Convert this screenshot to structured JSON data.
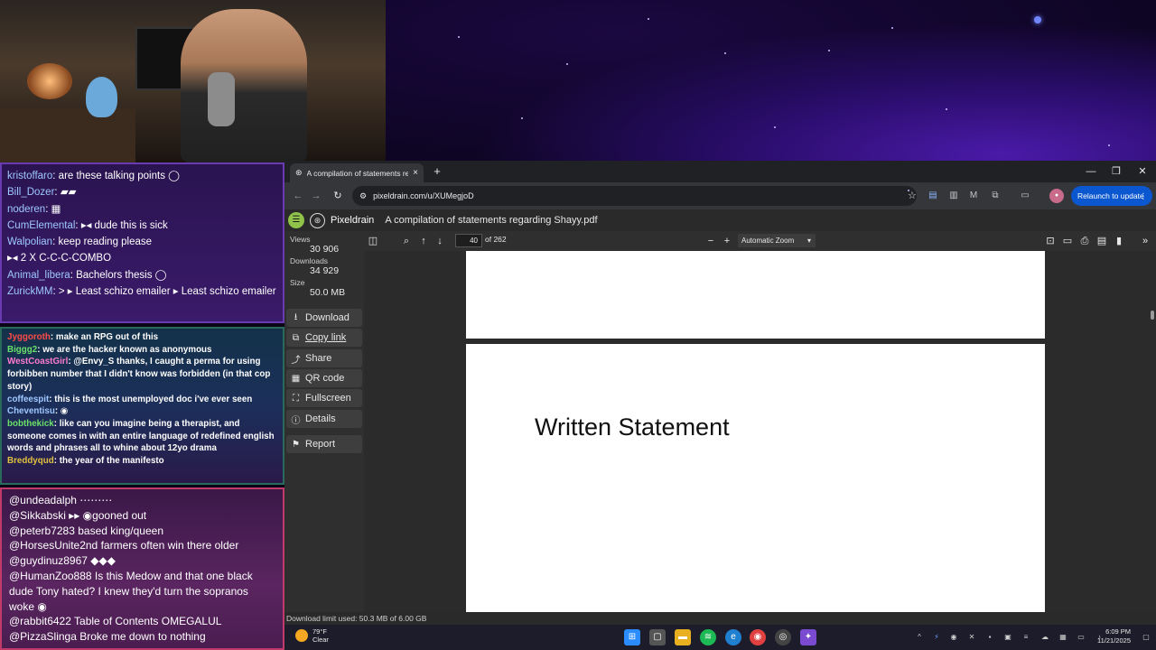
{
  "chat_top": [
    {
      "user": "kristoffaro",
      "msg": "are these talking points ◯"
    },
    {
      "user": "Bill_Dozer",
      "msg": "▰▰"
    },
    {
      "user": "noderen",
      "msg": "▦"
    },
    {
      "user": "CumElemental",
      "msg": "▸◂ dude this is sick"
    },
    {
      "user": "Walpolian",
      "msg": "keep reading please"
    },
    {
      "user": "",
      "msg": "▸◂ 2 X  C-C-C-COMBO"
    },
    {
      "user": "Animal_libera",
      "msg": "Bachelors thesis ◯"
    },
    {
      "user": "ZurickMM",
      "msg": ">  ▸  Least schizo emailer  ▸  Least schizo emailer"
    }
  ],
  "chat_mid": [
    {
      "user": "Jyggoroth",
      "msg": "make an RPG out of this",
      "color": "#ff4a4a"
    },
    {
      "user": "Biggg2",
      "msg": "we are the hacker known as anonymous",
      "color": "#6ae06a"
    },
    {
      "user": "WestCoastGirl",
      "msg": "@Envy_S thanks, I caught a perma for using forbibben number that I didn't know was forbidden (in that cop story)",
      "color": "#ff7ad0"
    },
    {
      "user": "coffeespit",
      "msg": "this is the most unemployed doc i've ever seen",
      "color": "#9ec8ff"
    },
    {
      "user": "Cheventisu",
      "msg": "◉",
      "color": "#9ec8ff"
    },
    {
      "user": "bobthekick",
      "msg": "like can you imagine being a therapist, and someone comes in with an entire language of redefined english words and phrases all to whine about 12yo drama",
      "color": "#6ae06a"
    },
    {
      "user": "Breddyqud",
      "msg": "the year of the manifesto",
      "color": "#e0c040"
    }
  ],
  "chat_bottom": [
    {
      "user": "@undeadalph",
      "msg": "⋯⋯⋯"
    },
    {
      "user": "@Sikkabski",
      "msg": "▸▸ ◉gooned out"
    },
    {
      "user": "@peterb7283",
      "msg": "based king/queen"
    },
    {
      "user": "@HorsesUnite2nd",
      "msg": "farmers often win there older"
    },
    {
      "user": "@guydinuz8967",
      "msg": "◆◆◆"
    },
    {
      "user": "@HumanZoo888",
      "msg": "Is this Medow and that one black dude Tony hated? I knew they'd turn the sopranos woke ◉"
    },
    {
      "user": "@rabbit6422",
      "msg": "Table of Contents OMEGALUL"
    },
    {
      "user": "@PizzaSlinga",
      "msg": "Broke me down to nothing"
    }
  ],
  "browser": {
    "tab_title": "A compilation of statements re...",
    "url": "pixeldrain.com/u/XUMegjoD",
    "relaunch_label": "Relaunch to update"
  },
  "pixeldrain": {
    "brand": "Pixeldrain",
    "file_name": "A compilation of statements regarding Shayy.pdf",
    "views_label": "Views",
    "views": "30 906",
    "downloads_label": "Downloads",
    "downloads": "34 929",
    "size_label": "Size",
    "size": "50.0 MB",
    "buttons": {
      "download": "Download",
      "copy_link": "Copy link",
      "share": "Share",
      "qr_code": "QR code",
      "fullscreen": "Fullscreen",
      "details": "Details",
      "report": "Report"
    },
    "download_limit": "Download limit used: 50.3 MB of 6.00 GB"
  },
  "pdf": {
    "page_number": "40",
    "page_total": "of 262",
    "zoom": "Automatic Zoom",
    "heading": "Written Statement"
  },
  "taskbar": {
    "temp": "79°F",
    "condition": "Clear",
    "time": "6:09 PM",
    "date": "11/21/2025"
  }
}
